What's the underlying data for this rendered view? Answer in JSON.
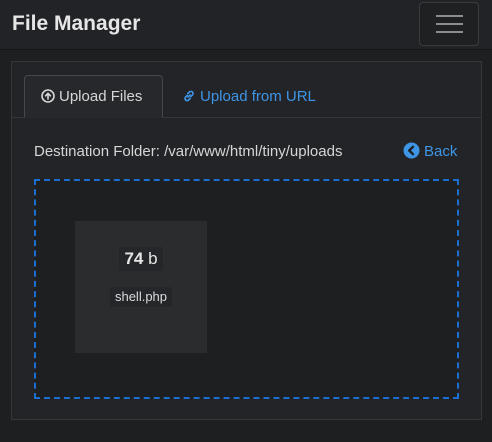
{
  "navbar": {
    "brand": "File Manager",
    "toggler_icon": "hamburger-menu-icon"
  },
  "tabs": [
    {
      "label": "Upload Files",
      "icon": "upload-circle-icon",
      "active": true
    },
    {
      "label": "Upload from URL",
      "icon": "link-icon",
      "active": false
    }
  ],
  "destination": {
    "text": "Destination Folder: /var/www/html/tiny/uploads"
  },
  "back": {
    "label": "Back",
    "icon": "arrow-circle-left-icon"
  },
  "upload": {
    "file": {
      "size_value": "74",
      "size_unit": "b",
      "name": "shell.php"
    }
  },
  "colors": {
    "accent": "#3e95e6",
    "dropzone_border": "#1c6fd1",
    "background": "#1e1f21"
  }
}
